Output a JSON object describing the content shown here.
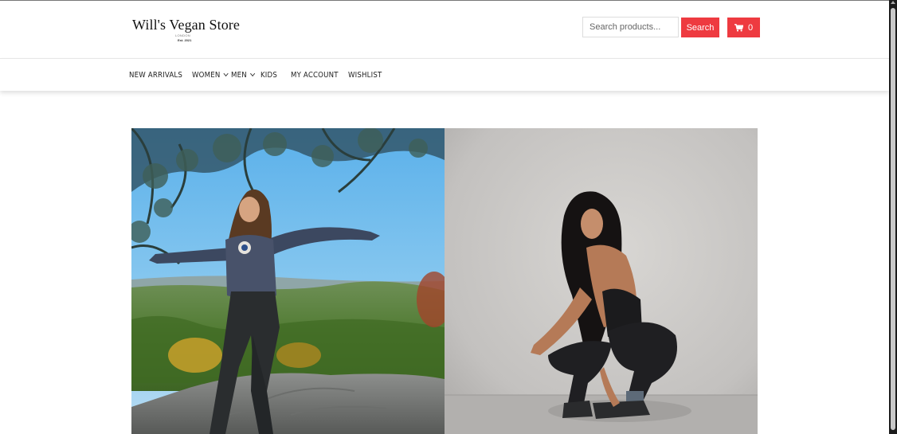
{
  "header": {
    "logo_title": "Will's Vegan Store",
    "logo_sub1": "LONDON",
    "logo_sub2": "Est. 2021",
    "search_placeholder": "Search products...",
    "search_label": "Search",
    "cart_count": "0"
  },
  "nav": {
    "items": [
      {
        "label": "NEW ARRIVALS"
      },
      {
        "label": "WOMEN"
      },
      {
        "label": "MEN"
      },
      {
        "label": "KIDS"
      },
      {
        "label": "MY ACCOUNT"
      },
      {
        "label": "WISHLIST"
      }
    ]
  },
  "hero": {
    "left_image": "woman-hiking-outdoors-photo",
    "right_image": "woman-crouching-studio-photo"
  },
  "colors": {
    "accent": "#ee3a40"
  },
  "icons": {
    "cart": "shopping-cart-icon",
    "dropdown": "chevron-down-icon"
  }
}
